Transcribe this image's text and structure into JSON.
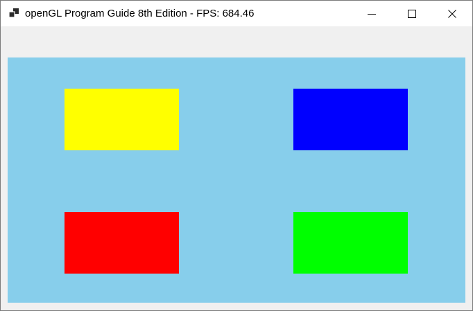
{
  "window": {
    "title": "openGL Program Guide 8th Edition - FPS: 684.46",
    "app_icon": "window-app-icon",
    "controls": {
      "minimize_icon": "minimize-icon",
      "maximize_icon": "maximize-icon",
      "close_icon": "close-icon"
    }
  },
  "colors": {
    "titlebar": "#ffffff",
    "client_background": "#f0f0f0",
    "canvas_clear": "#87ceeb",
    "quad_top_left": "#ffff00",
    "quad_top_right": "#0000ff",
    "quad_bottom_left": "#ff0000",
    "quad_bottom_right": "#00ff00"
  }
}
